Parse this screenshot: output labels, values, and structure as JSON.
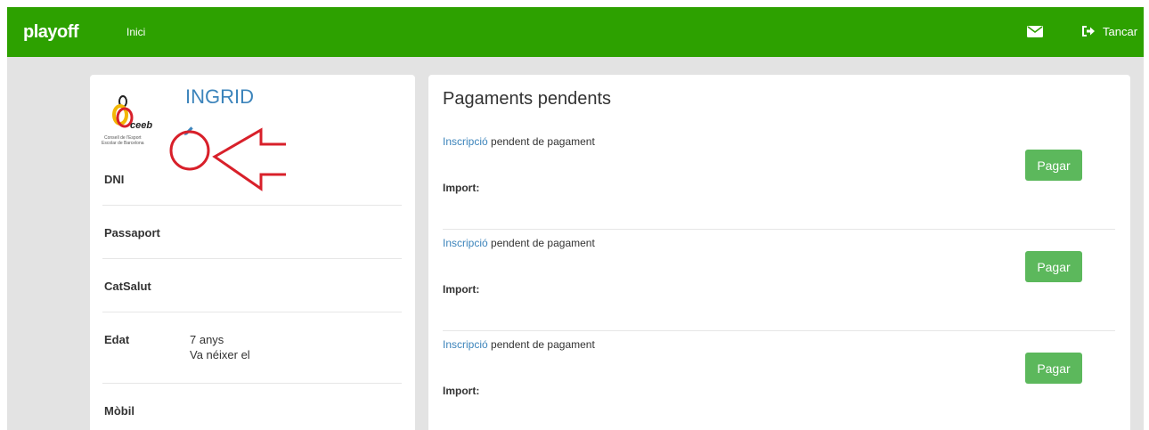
{
  "navbar": {
    "brand": "playoff",
    "home_link": "Inici",
    "logout_label": "Tancar",
    "mail_icon": "envelope-icon",
    "logout_icon": "sign-out-icon",
    "color": "#2da100"
  },
  "profile": {
    "name": "INGRID",
    "logo_text": "ceeb",
    "logo_subtitle_1": "Consell de l'Esport",
    "logo_subtitle_2": "Escolar de Barcelona",
    "edit_icon": "pencil-icon",
    "fields": [
      {
        "label": "DNI",
        "value": "",
        "value2": ""
      },
      {
        "label": "Passaport",
        "value": "",
        "value2": ""
      },
      {
        "label": "CatSalut",
        "value": "",
        "value2": ""
      },
      {
        "label": "Edat",
        "value": "7 anys",
        "value2": "Va néixer el"
      },
      {
        "label": "Mòbil",
        "value": "",
        "value2": ""
      }
    ]
  },
  "payments": {
    "title": "Pagaments pendents",
    "items": [
      {
        "link": "Inscripció",
        "text": "pendent de pagament",
        "import_label": "Import:",
        "button": "Pagar"
      },
      {
        "link": "Inscripció",
        "text": "pendent de pagament",
        "import_label": "Import:",
        "button": "Pagar"
      },
      {
        "link": "Inscripció",
        "text": "pendent de pagament",
        "import_label": "Import:",
        "button": "Pagar"
      }
    ]
  },
  "colors": {
    "link": "#3c84bb",
    "button": "#5cb85c",
    "annotation": "#d8202a"
  }
}
